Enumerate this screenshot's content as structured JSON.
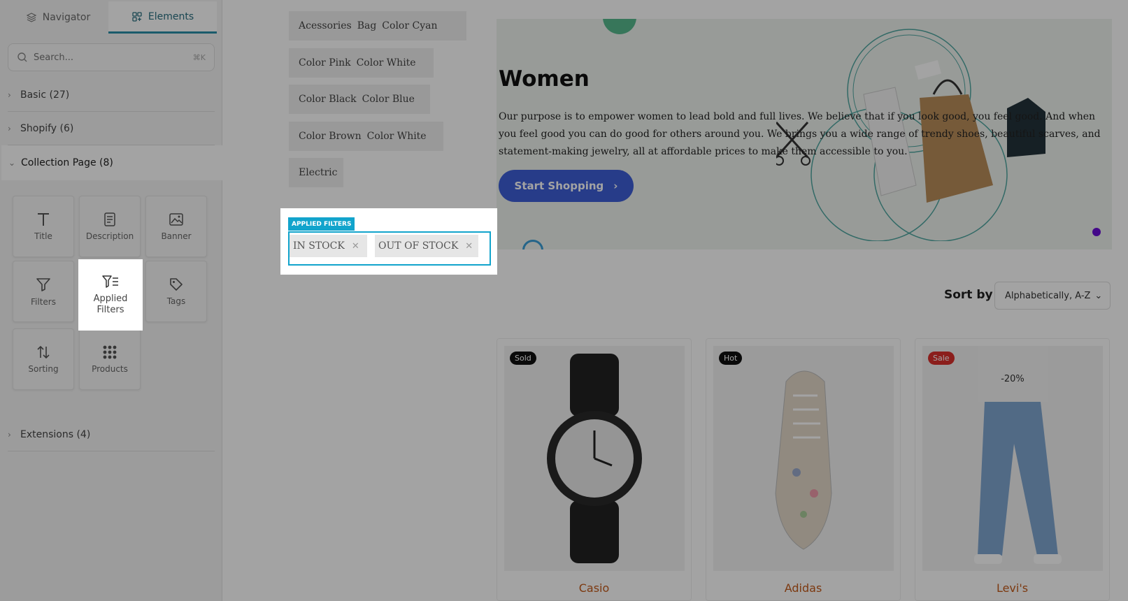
{
  "sidebar": {
    "tabs": [
      {
        "label": "Navigator"
      },
      {
        "label": "Elements"
      }
    ],
    "search": {
      "placeholder": "Search...",
      "shortcut": "⌘K"
    },
    "sections": {
      "basic": "Basic (27)",
      "shopify": "Shopify (6)",
      "collection_page": "Collection Page (8)",
      "extensions": "Extensions (4)"
    },
    "elements": [
      {
        "label": "Title",
        "icon": "title-icon"
      },
      {
        "label": "Description",
        "icon": "description-icon"
      },
      {
        "label": "Banner",
        "icon": "banner-icon"
      },
      {
        "label": "Filters",
        "icon": "filter-icon"
      },
      {
        "label": "Applied Filters",
        "icon": "applied-filters-icon"
      },
      {
        "label": "Tags",
        "icon": "tag-icon"
      },
      {
        "label": "Sorting",
        "icon": "sort-icon"
      },
      {
        "label": "Products",
        "icon": "grid-icon"
      }
    ]
  },
  "canvas": {
    "tags": [
      [
        "Acessories",
        "Bag",
        "Color Cyan"
      ],
      [
        "Color Pink",
        "Color White"
      ],
      [
        "Color Black",
        "Color Blue"
      ],
      [
        "Color Brown",
        "Color White"
      ],
      [
        "Electric"
      ]
    ],
    "applied_filters": {
      "label": "APPLIED FILTERS",
      "chips": [
        "IN STOCK",
        "OUT OF STOCK"
      ]
    },
    "hero": {
      "title": "Women",
      "text": "Our purpose is to empower women to lead bold and full lives. We believe that if you look good, you feel good. And when you feel good you can do good for others around you. We brings you a wide range of trendy shoes, beautiful scarves, and statement-making jewelry, all at affordable prices to make them accessible to you.",
      "cta": "Start Shopping"
    },
    "sort": {
      "label": "Sort by",
      "value": "Alphabetically, A-Z"
    },
    "products": [
      {
        "name": "Casio",
        "badge": "Sold",
        "badge_color": "#111111",
        "discount": ""
      },
      {
        "name": "Adidas",
        "badge": "Hot",
        "badge_color": "#111111",
        "discount": ""
      },
      {
        "name": "Levi's",
        "badge": "Sale",
        "badge_color": "#d9302c",
        "discount": "-20%"
      }
    ]
  },
  "colors": {
    "accent": "#12a4cc",
    "cta": "#3d5fd6",
    "product_name": "#c35a1a"
  }
}
